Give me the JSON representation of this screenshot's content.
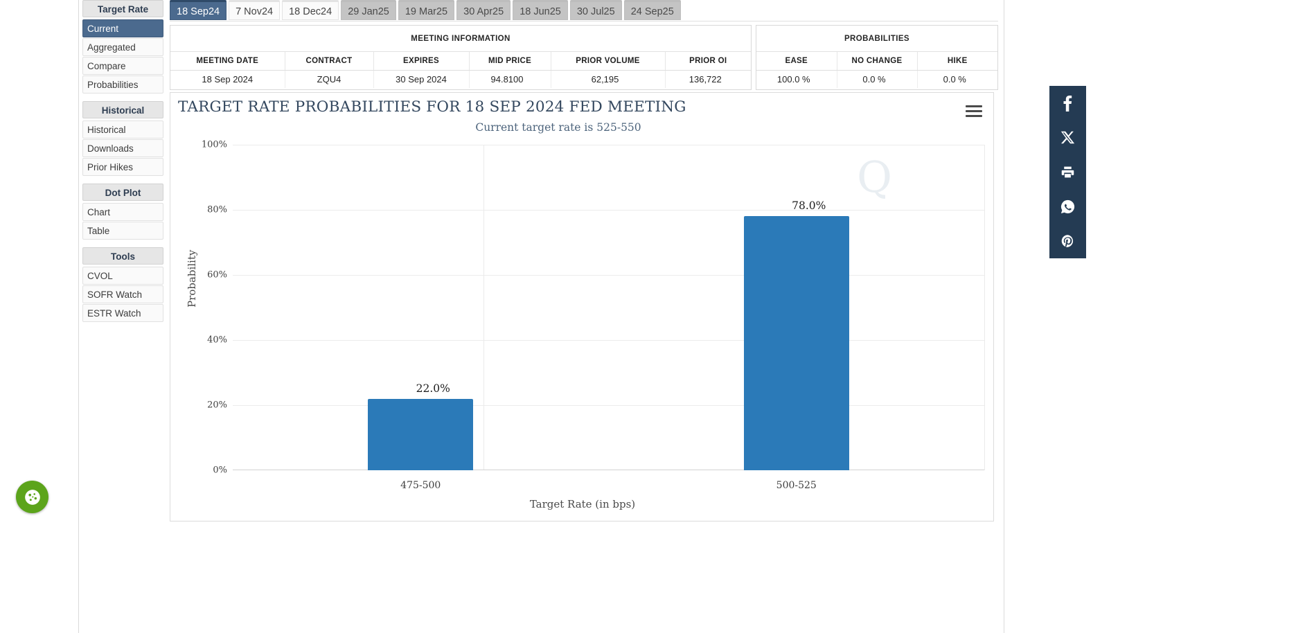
{
  "sidebar": {
    "groups": [
      {
        "header": "Target Rate",
        "items": [
          {
            "label": "Current",
            "active": true
          },
          {
            "label": "Aggregated",
            "active": false
          },
          {
            "label": "Compare",
            "active": false
          },
          {
            "label": "Probabilities",
            "active": false
          }
        ]
      },
      {
        "header": "Historical",
        "items": [
          {
            "label": "Historical",
            "active": false
          },
          {
            "label": "Downloads",
            "active": false
          },
          {
            "label": "Prior Hikes",
            "active": false
          }
        ]
      },
      {
        "header": "Dot Plot",
        "items": [
          {
            "label": "Chart",
            "active": false
          },
          {
            "label": "Table",
            "active": false
          }
        ]
      },
      {
        "header": "Tools",
        "items": [
          {
            "label": "CVOL",
            "active": false
          },
          {
            "label": "SOFR Watch",
            "active": false
          },
          {
            "label": "ESTR Watch",
            "active": false
          }
        ]
      }
    ]
  },
  "tabs": [
    {
      "label": "18 Sep24",
      "state": "active"
    },
    {
      "label": "7 Nov24",
      "state": "light"
    },
    {
      "label": "18 Dec24",
      "state": "light"
    },
    {
      "label": "29 Jan25",
      "state": "grey"
    },
    {
      "label": "19 Mar25",
      "state": "grey"
    },
    {
      "label": "30 Apr25",
      "state": "grey"
    },
    {
      "label": "18 Jun25",
      "state": "grey"
    },
    {
      "label": "30 Jul25",
      "state": "grey"
    },
    {
      "label": "24 Sep25",
      "state": "grey"
    }
  ],
  "meeting_panel": {
    "title": "MEETING INFORMATION",
    "columns": [
      "MEETING DATE",
      "CONTRACT",
      "EXPIRES",
      "MID PRICE",
      "PRIOR VOLUME",
      "PRIOR OI"
    ],
    "row": [
      "18 Sep 2024",
      "ZQU4",
      "30 Sep 2024",
      "94.8100",
      "62,195",
      "136,722"
    ]
  },
  "probabilities_panel": {
    "title": "PROBABILITIES",
    "columns": [
      "EASE",
      "NO CHANGE",
      "HIKE"
    ],
    "row": [
      "100.0 %",
      "0.0 %",
      "0.0 %"
    ]
  },
  "chart_data": {
    "type": "bar",
    "title": "TARGET RATE PROBABILITIES FOR 18 SEP 2024 FED MEETING",
    "subtitle": "Current target rate is 525-550",
    "xlabel": "Target Rate (in bps)",
    "ylabel": "Probability",
    "categories": [
      "475-500",
      "500-525"
    ],
    "values": [
      22.0,
      78.0
    ],
    "data_labels": [
      "22.0%",
      "78.0%"
    ],
    "ylim": [
      0,
      100
    ],
    "yticks": [
      0,
      20,
      40,
      60,
      80,
      100
    ],
    "ytick_labels": [
      "0%",
      "20%",
      "40%",
      "60%",
      "80%",
      "100%"
    ],
    "grid": true,
    "legend": "none",
    "bar_color": "#2b7ab8",
    "watermark": "Q"
  },
  "chart_menu": {
    "icon": "hamburger-menu-icon"
  },
  "social": {
    "items": [
      {
        "name": "facebook-share-icon",
        "glyph": "f"
      },
      {
        "name": "x-twitter-share-icon",
        "glyph": "X"
      },
      {
        "name": "print-icon",
        "glyph": "print"
      },
      {
        "name": "whatsapp-share-icon",
        "glyph": "whatsapp"
      },
      {
        "name": "pinterest-share-icon",
        "glyph": "P"
      }
    ],
    "background": "#243b53"
  },
  "cookie_widget": {
    "name": "cookie-consent-button",
    "color": "#5ca41b"
  }
}
